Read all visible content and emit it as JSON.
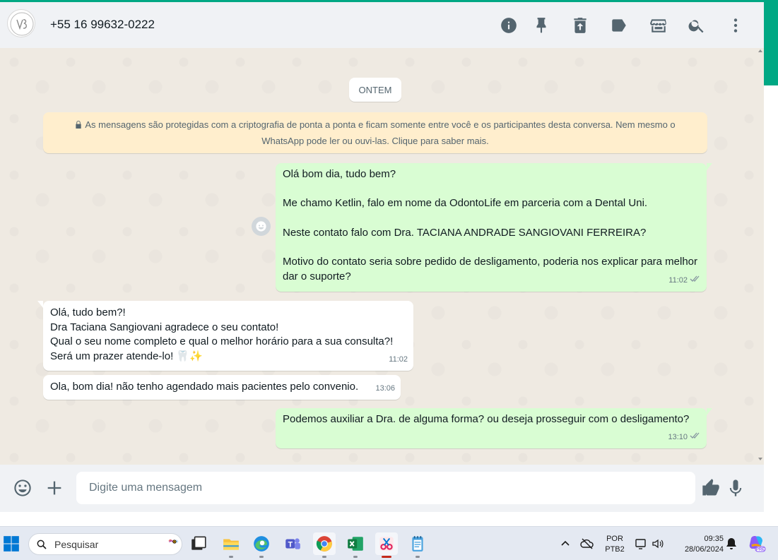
{
  "header": {
    "contact": "+55 16 99632-0222",
    "icons": [
      "info-icon",
      "pin-icon",
      "delete-icon",
      "label-icon",
      "store-icon",
      "search-icon",
      "menu-icon"
    ]
  },
  "chat": {
    "date_divider": "ONTEM",
    "encryption_notice": "As mensagens são protegidas com a criptografia de ponta a ponta e ficam somente entre você e os participantes desta conversa. Nem mesmo o WhatsApp pode ler ou ouvi-las. Clique para saber mais.",
    "messages": [
      {
        "direction": "out",
        "text": "Olá bom dia, tudo bem?\n\nMe chamo Ketlin, falo em nome da OdontoLife em parceria com a Dental Uni.\n\nNeste contato falo com Dra. TACIANA ANDRADE SANGIOVANI FERREIRA?\n\nMotivo do contato seria sobre pedido de desligamento, poderia nos explicar para melhor dar o suporte?",
        "time": "11:02",
        "status": "read"
      },
      {
        "direction": "in",
        "text": "Olá, tudo bem?!\nDra Taciana Sangiovani agradece o seu contato!\nQual o seu nome completo e qual o melhor horário para a sua consulta?!\nSerá um prazer atende-lo! 🦷✨",
        "time": "11:02"
      },
      {
        "direction": "in",
        "text": "Ola, bom dia! não tenho agendado mais pacientes pelo convenio.",
        "time": "13:06"
      },
      {
        "direction": "out",
        "text": "Podemos auxiliar a Dra. de alguma forma? ou deseja prosseguir com o desligamento?",
        "time": "13:10",
        "status": "read"
      }
    ]
  },
  "composer": {
    "placeholder": "Digite uma mensagem"
  },
  "taskbar": {
    "search_label": "Pesquisar",
    "language_line1": "POR",
    "language_line2": "PTB2",
    "time": "09:35",
    "date": "28/06/2024",
    "badge": "PRE"
  },
  "colors": {
    "accent": "#00a884",
    "outgoing_bubble": "#d9fdd3",
    "incoming_bubble": "#ffffff",
    "chat_background": "#efeae2",
    "encryption_bg": "#ffeecd"
  }
}
